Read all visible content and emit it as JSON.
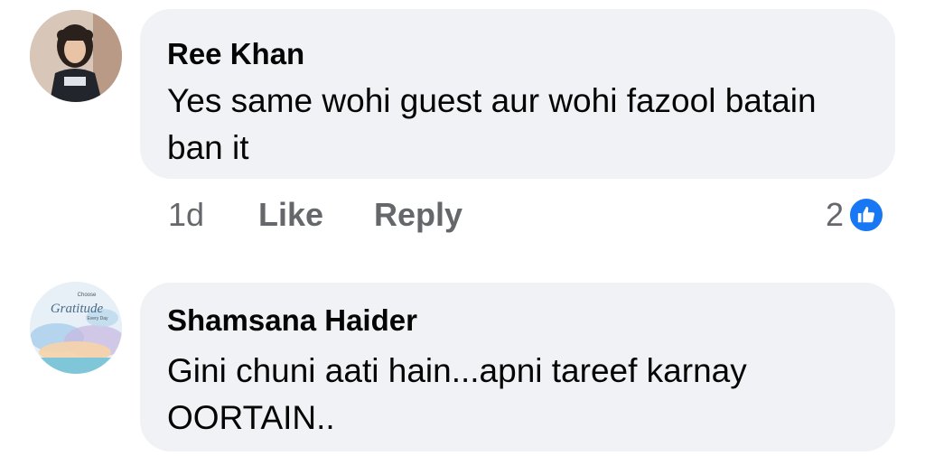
{
  "comments": [
    {
      "author": "Ree Khan",
      "text": "Yes same wohi guest aur wohi fazool batain ban it",
      "avatar_icon": "girl-photo-avatar",
      "time": "1d",
      "like_label": "Like",
      "reply_label": "Reply",
      "reaction_count": "2",
      "reaction_icon": "thumbs-up-icon"
    },
    {
      "author": "Shamsana Haider",
      "text": "Gini chuni aati hain...apni tareef karnay OORTAIN..",
      "avatar_icon": "gratitude-watercolor-avatar",
      "avatar_text": {
        "line1": "Choose",
        "line2": "Gratitude",
        "line3": "Every Day"
      }
    }
  ],
  "colors": {
    "bubble": "#f0f2f5",
    "text": "#050505",
    "meta": "#65676b",
    "accent": "#1877f2"
  }
}
